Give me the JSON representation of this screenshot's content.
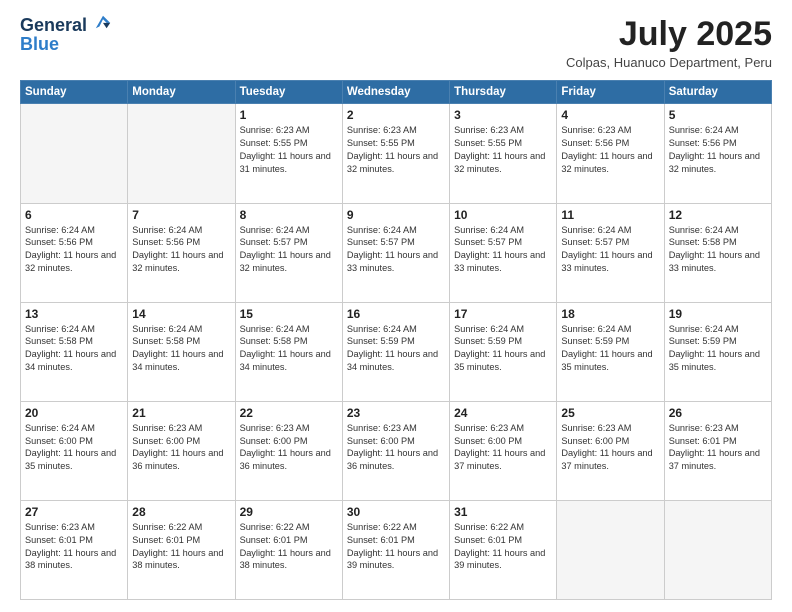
{
  "header": {
    "logo_line1": "General",
    "logo_line2": "Blue",
    "month_year": "July 2025",
    "location": "Colpas, Huanuco Department, Peru"
  },
  "weekdays": [
    "Sunday",
    "Monday",
    "Tuesday",
    "Wednesday",
    "Thursday",
    "Friday",
    "Saturday"
  ],
  "weeks": [
    [
      {
        "day": "",
        "sunrise": "",
        "sunset": "",
        "daylight": ""
      },
      {
        "day": "",
        "sunrise": "",
        "sunset": "",
        "daylight": ""
      },
      {
        "day": "1",
        "sunrise": "Sunrise: 6:23 AM",
        "sunset": "Sunset: 5:55 PM",
        "daylight": "Daylight: 11 hours and 31 minutes."
      },
      {
        "day": "2",
        "sunrise": "Sunrise: 6:23 AM",
        "sunset": "Sunset: 5:55 PM",
        "daylight": "Daylight: 11 hours and 32 minutes."
      },
      {
        "day": "3",
        "sunrise": "Sunrise: 6:23 AM",
        "sunset": "Sunset: 5:55 PM",
        "daylight": "Daylight: 11 hours and 32 minutes."
      },
      {
        "day": "4",
        "sunrise": "Sunrise: 6:23 AM",
        "sunset": "Sunset: 5:56 PM",
        "daylight": "Daylight: 11 hours and 32 minutes."
      },
      {
        "day": "5",
        "sunrise": "Sunrise: 6:24 AM",
        "sunset": "Sunset: 5:56 PM",
        "daylight": "Daylight: 11 hours and 32 minutes."
      }
    ],
    [
      {
        "day": "6",
        "sunrise": "Sunrise: 6:24 AM",
        "sunset": "Sunset: 5:56 PM",
        "daylight": "Daylight: 11 hours and 32 minutes."
      },
      {
        "day": "7",
        "sunrise": "Sunrise: 6:24 AM",
        "sunset": "Sunset: 5:56 PM",
        "daylight": "Daylight: 11 hours and 32 minutes."
      },
      {
        "day": "8",
        "sunrise": "Sunrise: 6:24 AM",
        "sunset": "Sunset: 5:57 PM",
        "daylight": "Daylight: 11 hours and 32 minutes."
      },
      {
        "day": "9",
        "sunrise": "Sunrise: 6:24 AM",
        "sunset": "Sunset: 5:57 PM",
        "daylight": "Daylight: 11 hours and 33 minutes."
      },
      {
        "day": "10",
        "sunrise": "Sunrise: 6:24 AM",
        "sunset": "Sunset: 5:57 PM",
        "daylight": "Daylight: 11 hours and 33 minutes."
      },
      {
        "day": "11",
        "sunrise": "Sunrise: 6:24 AM",
        "sunset": "Sunset: 5:57 PM",
        "daylight": "Daylight: 11 hours and 33 minutes."
      },
      {
        "day": "12",
        "sunrise": "Sunrise: 6:24 AM",
        "sunset": "Sunset: 5:58 PM",
        "daylight": "Daylight: 11 hours and 33 minutes."
      }
    ],
    [
      {
        "day": "13",
        "sunrise": "Sunrise: 6:24 AM",
        "sunset": "Sunset: 5:58 PM",
        "daylight": "Daylight: 11 hours and 34 minutes."
      },
      {
        "day": "14",
        "sunrise": "Sunrise: 6:24 AM",
        "sunset": "Sunset: 5:58 PM",
        "daylight": "Daylight: 11 hours and 34 minutes."
      },
      {
        "day": "15",
        "sunrise": "Sunrise: 6:24 AM",
        "sunset": "Sunset: 5:58 PM",
        "daylight": "Daylight: 11 hours and 34 minutes."
      },
      {
        "day": "16",
        "sunrise": "Sunrise: 6:24 AM",
        "sunset": "Sunset: 5:59 PM",
        "daylight": "Daylight: 11 hours and 34 minutes."
      },
      {
        "day": "17",
        "sunrise": "Sunrise: 6:24 AM",
        "sunset": "Sunset: 5:59 PM",
        "daylight": "Daylight: 11 hours and 35 minutes."
      },
      {
        "day": "18",
        "sunrise": "Sunrise: 6:24 AM",
        "sunset": "Sunset: 5:59 PM",
        "daylight": "Daylight: 11 hours and 35 minutes."
      },
      {
        "day": "19",
        "sunrise": "Sunrise: 6:24 AM",
        "sunset": "Sunset: 5:59 PM",
        "daylight": "Daylight: 11 hours and 35 minutes."
      }
    ],
    [
      {
        "day": "20",
        "sunrise": "Sunrise: 6:24 AM",
        "sunset": "Sunset: 6:00 PM",
        "daylight": "Daylight: 11 hours and 35 minutes."
      },
      {
        "day": "21",
        "sunrise": "Sunrise: 6:23 AM",
        "sunset": "Sunset: 6:00 PM",
        "daylight": "Daylight: 11 hours and 36 minutes."
      },
      {
        "day": "22",
        "sunrise": "Sunrise: 6:23 AM",
        "sunset": "Sunset: 6:00 PM",
        "daylight": "Daylight: 11 hours and 36 minutes."
      },
      {
        "day": "23",
        "sunrise": "Sunrise: 6:23 AM",
        "sunset": "Sunset: 6:00 PM",
        "daylight": "Daylight: 11 hours and 36 minutes."
      },
      {
        "day": "24",
        "sunrise": "Sunrise: 6:23 AM",
        "sunset": "Sunset: 6:00 PM",
        "daylight": "Daylight: 11 hours and 37 minutes."
      },
      {
        "day": "25",
        "sunrise": "Sunrise: 6:23 AM",
        "sunset": "Sunset: 6:00 PM",
        "daylight": "Daylight: 11 hours and 37 minutes."
      },
      {
        "day": "26",
        "sunrise": "Sunrise: 6:23 AM",
        "sunset": "Sunset: 6:01 PM",
        "daylight": "Daylight: 11 hours and 37 minutes."
      }
    ],
    [
      {
        "day": "27",
        "sunrise": "Sunrise: 6:23 AM",
        "sunset": "Sunset: 6:01 PM",
        "daylight": "Daylight: 11 hours and 38 minutes."
      },
      {
        "day": "28",
        "sunrise": "Sunrise: 6:22 AM",
        "sunset": "Sunset: 6:01 PM",
        "daylight": "Daylight: 11 hours and 38 minutes."
      },
      {
        "day": "29",
        "sunrise": "Sunrise: 6:22 AM",
        "sunset": "Sunset: 6:01 PM",
        "daylight": "Daylight: 11 hours and 38 minutes."
      },
      {
        "day": "30",
        "sunrise": "Sunrise: 6:22 AM",
        "sunset": "Sunset: 6:01 PM",
        "daylight": "Daylight: 11 hours and 39 minutes."
      },
      {
        "day": "31",
        "sunrise": "Sunrise: 6:22 AM",
        "sunset": "Sunset: 6:01 PM",
        "daylight": "Daylight: 11 hours and 39 minutes."
      },
      {
        "day": "",
        "sunrise": "",
        "sunset": "",
        "daylight": ""
      },
      {
        "day": "",
        "sunrise": "",
        "sunset": "",
        "daylight": ""
      }
    ]
  ]
}
